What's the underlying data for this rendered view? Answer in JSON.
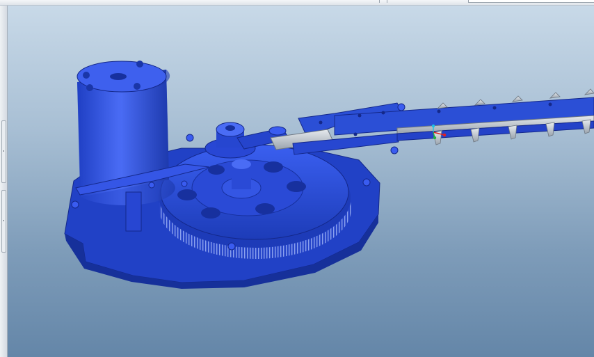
{
  "window": {
    "title": ""
  },
  "viewport": {
    "background_top": "#c8d9e8",
    "background_bottom": "#6486a8",
    "model_color": "#2b4fd6",
    "blade_color": "#c9cfd6",
    "triad_colors": {
      "x": "#e02020",
      "y": "#20b040",
      "z": "#20c0e0"
    }
  },
  "icons": {
    "rail_handle_top": "grip-handle-icon",
    "rail_handle_bottom": "grip-handle-icon",
    "triad": "coordinate-triad-icon"
  }
}
